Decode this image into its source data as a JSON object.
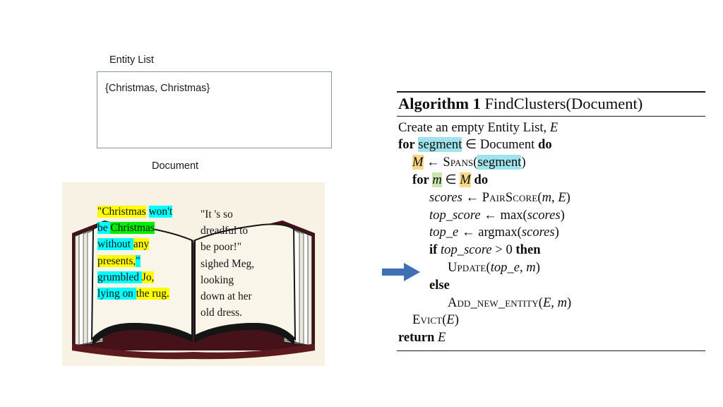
{
  "entity_list": {
    "label": "Entity List",
    "value": "{Christmas, Christmas}"
  },
  "document": {
    "label": "Document",
    "left_page": [
      [
        {
          "t": "\"Christmas",
          "hl": "yellow"
        },
        {
          "t": " ",
          "hl": "none"
        },
        {
          "t": "won't",
          "hl": "cyan"
        }
      ],
      [
        {
          "t": "be ",
          "hl": "cyan"
        },
        {
          "t": "Christmas",
          "hl": "green"
        }
      ],
      [
        {
          "t": "without ",
          "hl": "cyan"
        },
        {
          "t": "any",
          "hl": "yellow"
        }
      ],
      [
        {
          "t": "presents,",
          "hl": "yellow"
        },
        {
          "t": "\"",
          "hl": "cyan"
        }
      ],
      [
        {
          "t": "grumbled ",
          "hl": "cyan"
        },
        {
          "t": "Jo,",
          "hl": "yellow"
        }
      ],
      [
        {
          "t": "lying on ",
          "hl": "cyan"
        },
        {
          "t": "the rug.",
          "hl": "yellow"
        }
      ]
    ],
    "right_page": [
      "\"It 's so",
      "dreadful to",
      "be poor!\"",
      "sighed Meg,",
      "looking",
      "down at her",
      "old dress."
    ]
  },
  "arrow": {
    "name": "current-step-arrow",
    "color": "#3f6fb5",
    "direction": "right"
  },
  "algorithm": {
    "title_prefix": "Algorithm 1",
    "title_name": "FindClusters(Document)",
    "lines": [
      {
        "indent": 0,
        "text": "Create an empty Entity List, E"
      },
      {
        "indent": 0,
        "text": "for segment ∈ Document do"
      },
      {
        "indent": 1,
        "text": "M ← Spans(segment)"
      },
      {
        "indent": 1,
        "text": "for m ∈ M do"
      },
      {
        "indent": 2,
        "text": "scores ← PairScore(m, E)"
      },
      {
        "indent": 2,
        "text": "top_score ← max(scores)"
      },
      {
        "indent": 2,
        "text": "top_e ← argmax(scores)"
      },
      {
        "indent": 2,
        "text": "if top_score > 0 then"
      },
      {
        "indent": 3,
        "text": "Update(top_e, m)"
      },
      {
        "indent": 2,
        "text": "else"
      },
      {
        "indent": 3,
        "text": "Add_new_entity(E, m)"
      },
      {
        "indent": 1,
        "text": "Evict(E)"
      },
      {
        "indent": 0,
        "text": "return E"
      }
    ],
    "highlight_colors": {
      "segment": "#9fe4ec",
      "m": "#c7e5ac",
      "M": "#fbd887"
    }
  },
  "palette": {
    "box_border": "#8496b0",
    "figure_background": "#f7f2e3",
    "book_cover": "#4a1418",
    "book_page": "#f7f4e6",
    "highlight_yellow": "#ffff00",
    "highlight_cyan": "#00ffff",
    "highlight_green": "#00ee00",
    "arrow_blue": "#3f6fb5"
  }
}
